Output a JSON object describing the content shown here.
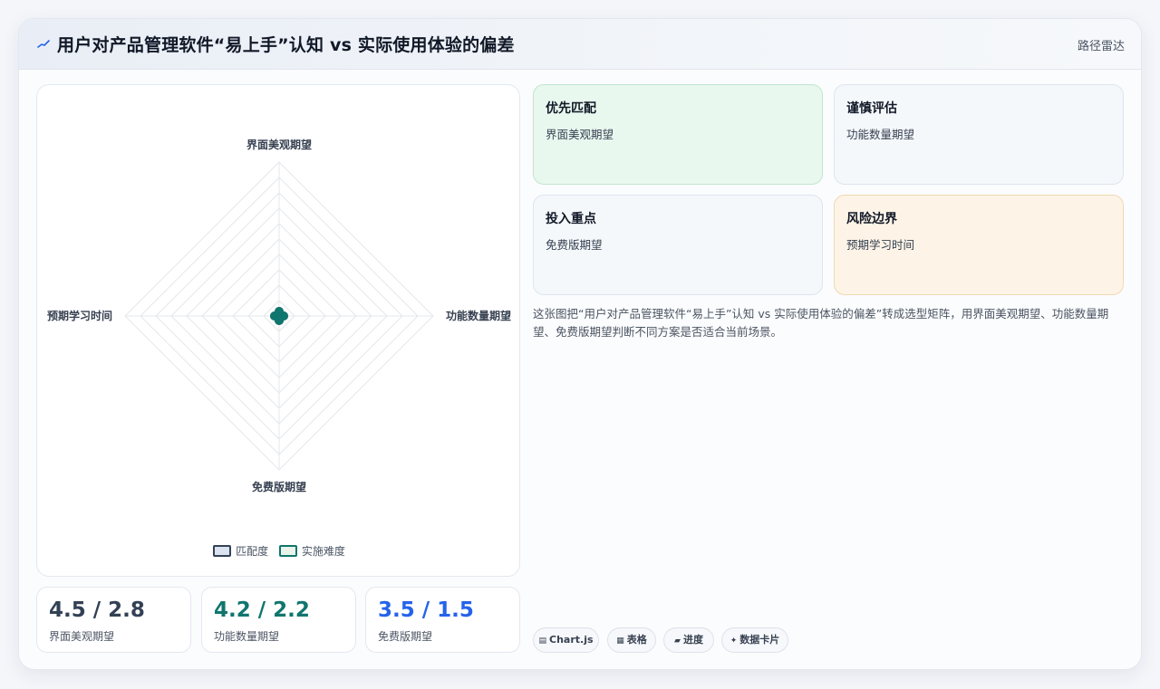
{
  "header": {
    "icon": "chart-line-icon",
    "title": "用户对产品管理软件“易上手”认知 vs 实际使用体验的偏差",
    "link_label": "路径雷达"
  },
  "chart_data": {
    "type": "radar",
    "axes": [
      "界面美观期望",
      "功能数量期望",
      "免费版期望",
      "预期学习时间"
    ],
    "series": [
      {
        "name": "匹配度",
        "values": [
          0,
          0,
          0,
          0
        ]
      },
      {
        "name": "实施难度",
        "values": [
          0,
          0,
          0,
          0
        ]
      }
    ],
    "rlim": [
      0,
      10
    ],
    "grid_rings": 10,
    "legend": "bottom",
    "colors": {
      "匹配度": "#334155",
      "实施难度": "#0f766e"
    }
  },
  "stats": [
    {
      "value": "4.5 / 2.8",
      "label": "界面美观期望",
      "color": "#334155"
    },
    {
      "value": "4.2 / 2.2",
      "label": "功能数量期望",
      "color": "#0f766e"
    },
    {
      "value": "3.5 / 1.5",
      "label": "免费版期望",
      "color": "#2563eb"
    }
  ],
  "tiles": [
    {
      "title": "优先匹配",
      "subtitle": "界面美观期望",
      "tone": "green"
    },
    {
      "title": "谨慎评估",
      "subtitle": "功能数量期望",
      "tone": "neutral"
    },
    {
      "title": "投入重点",
      "subtitle": "免费版期望",
      "tone": "neutral"
    },
    {
      "title": "风险边界",
      "subtitle": "预期学习时间",
      "tone": "orange"
    }
  ],
  "description": "这张图把“用户对产品管理软件“易上手”认知 vs 实际使用体验的偏差”转成选型矩阵，用界面美观期望、功能数量期望、免费版期望判断不同方案是否适合当前场景。",
  "chips": [
    {
      "icon": "table-icon",
      "glyph": "▤",
      "label": "Chart.js"
    },
    {
      "icon": "grid-icon",
      "glyph": "▦",
      "label": "表格"
    },
    {
      "icon": "progress-icon",
      "glyph": "▰",
      "label": "进度"
    },
    {
      "icon": "sparkle-icon",
      "glyph": "✦",
      "label": "数据卡片"
    }
  ]
}
